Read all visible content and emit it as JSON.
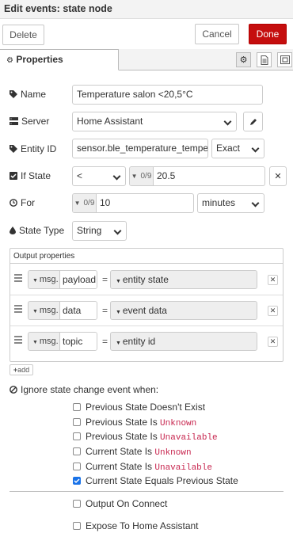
{
  "title": "Edit events: state node",
  "buttons": {
    "delete": "Delete",
    "cancel": "Cancel",
    "done": "Done"
  },
  "tabs": {
    "properties": "Properties"
  },
  "fields": {
    "name": {
      "label": "Name",
      "value": "Temperature salon <20,5°C"
    },
    "server": {
      "label": "Server",
      "value": "Home Assistant"
    },
    "entity_id": {
      "label": "Entity ID",
      "value": "sensor.ble_temperature_temperatu",
      "match": "Exact"
    },
    "if_state": {
      "label": "If State",
      "operator": "<",
      "type_prefix": "0/9",
      "value": "20.5"
    },
    "for": {
      "label": "For",
      "type_prefix": "0/9",
      "value": "10",
      "unit": "minutes"
    },
    "state_type": {
      "label": "State Type",
      "value": "String"
    }
  },
  "output_properties": {
    "header": "Output properties",
    "rows": [
      {
        "prefix": "msg.",
        "property": "payload",
        "value": "entity state"
      },
      {
        "prefix": "msg.",
        "property": "data",
        "value": "event data"
      },
      {
        "prefix": "msg.",
        "property": "topic",
        "value": "entity id"
      }
    ],
    "add_label": "add",
    "eq": "="
  },
  "ignore": {
    "label": "Ignore state change event when:",
    "items": [
      {
        "text": "Previous State Doesn't Exist",
        "code": "",
        "checked": false
      },
      {
        "text": "Previous State Is ",
        "code": "Unknown",
        "checked": false
      },
      {
        "text": "Previous State Is ",
        "code": "Unavailable",
        "checked": false
      },
      {
        "text": "Current State Is ",
        "code": "Unknown",
        "checked": false
      },
      {
        "text": "Current State Is ",
        "code": "Unavailable",
        "checked": false
      },
      {
        "text": "Current State Equals Previous State",
        "code": "",
        "checked": true
      }
    ]
  },
  "options": {
    "output_on_connect": {
      "label": "Output On Connect",
      "checked": false
    },
    "expose": {
      "label": "Expose To Home Assistant",
      "checked": false
    }
  },
  "colors": {
    "accent": "#c50e0e",
    "checkbox": "#1a73e8"
  }
}
